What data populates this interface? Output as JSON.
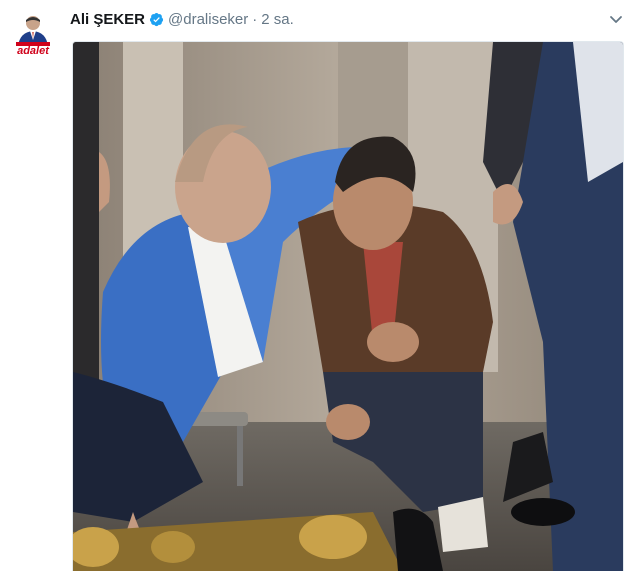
{
  "tweet": {
    "author_name": "Ali ŞEKER",
    "handle": "@draliseker",
    "separator": "·",
    "time": "2 sa.",
    "verified": true,
    "avatar_logo_text": "adalet"
  },
  "icons": {
    "verified": "verified-badge-icon",
    "menu": "chevron-down-icon"
  },
  "colors": {
    "verified_blue": "#1da1f2",
    "logo_red": "#d0021b",
    "jacket_blue": "#3a6fc4",
    "jacket_brown": "#5a3b28"
  }
}
